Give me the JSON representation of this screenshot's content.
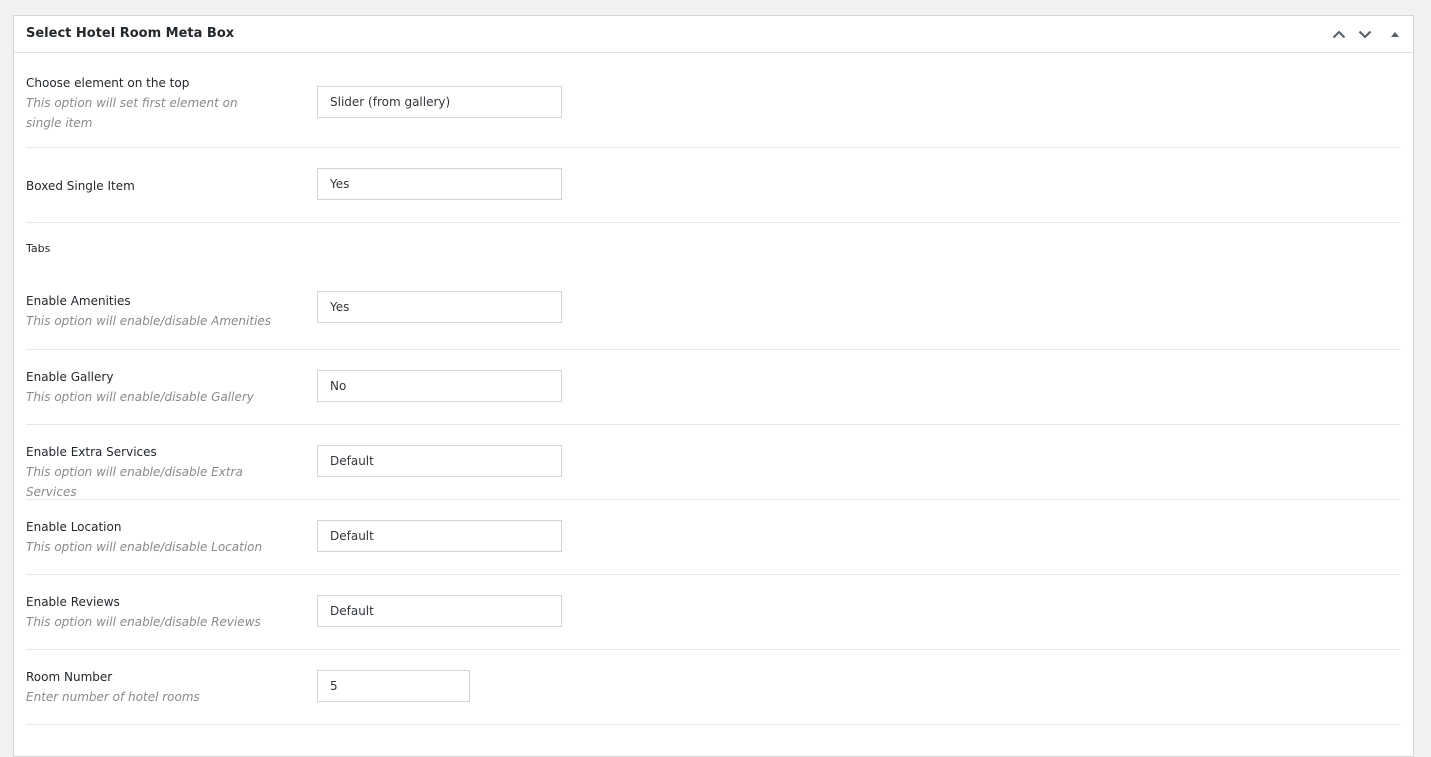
{
  "metabox": {
    "title": "Select Hotel Room Meta Box",
    "controls": {
      "move_up": "chevron-up-icon",
      "move_down": "chevron-down-icon",
      "toggle": "triangle-up-icon"
    }
  },
  "fields": {
    "top_element": {
      "label": "Choose element on the top",
      "description": "This option will set first element on single item",
      "value": "Slider (from gallery)"
    },
    "boxed_single": {
      "label": "Boxed Single Item",
      "value": "Yes"
    },
    "tabs_heading": "Tabs",
    "amenities": {
      "label": "Enable Amenities",
      "description": "This option will enable/disable Amenities",
      "value": "Yes"
    },
    "gallery": {
      "label": "Enable Gallery",
      "description": "This option will enable/disable Gallery",
      "value": "No"
    },
    "extra_services": {
      "label": "Enable Extra Services",
      "description": "This option will enable/disable Extra Services",
      "value": "Default"
    },
    "location": {
      "label": "Enable Location",
      "description": "This option will enable/disable Location",
      "value": "Default"
    },
    "reviews": {
      "label": "Enable Reviews",
      "description": "This option will enable/disable Reviews",
      "value": "Default"
    },
    "room_number": {
      "label": "Room Number",
      "description": "Enter number of hotel rooms",
      "value": "5"
    }
  },
  "colors": {
    "background": "#f1f1f1",
    "panel": "#ffffff",
    "border": "#d5d5d5",
    "description_text": "#8a8a8a"
  }
}
